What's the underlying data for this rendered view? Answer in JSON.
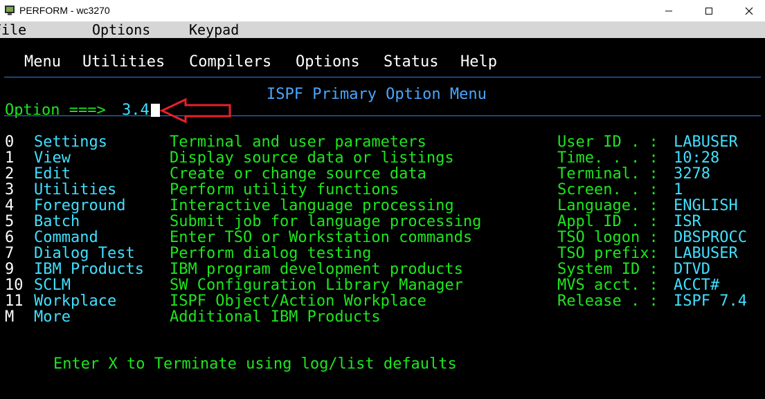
{
  "window": {
    "title": "PERFORM - wc3270",
    "icon": "terminal-icon",
    "controls": [
      "minimize-icon",
      "maximize-icon",
      "close-icon"
    ]
  },
  "menubar": {
    "items": [
      "File",
      "Options",
      "Keypad"
    ]
  },
  "action_bar": {
    "items": [
      "Menu",
      "Utilities",
      "Compilers",
      "Options",
      "Status",
      "Help"
    ]
  },
  "panel": {
    "title": "ISPF Primary Option Menu",
    "option_prompt": "Option ===>",
    "option_value": "3.4"
  },
  "options": [
    {
      "key": "0",
      "name": "Settings",
      "desc": "Terminal and user parameters"
    },
    {
      "key": "1",
      "name": "View",
      "desc": "Display source data or listings"
    },
    {
      "key": "2",
      "name": "Edit",
      "desc": "Create or change source data"
    },
    {
      "key": "3",
      "name": "Utilities",
      "desc": "Perform utility functions"
    },
    {
      "key": "4",
      "name": "Foreground",
      "desc": "Interactive language processing"
    },
    {
      "key": "5",
      "name": "Batch",
      "desc": "Submit job for language processing"
    },
    {
      "key": "6",
      "name": "Command",
      "desc": "Enter TSO or Workstation commands"
    },
    {
      "key": "7",
      "name": "Dialog Test",
      "desc": "Perform dialog testing"
    },
    {
      "key": "9",
      "name": "IBM Products",
      "desc": "IBM program development products"
    },
    {
      "key": "10",
      "name": "SCLM",
      "desc": "SW Configuration Library Manager"
    },
    {
      "key": "11",
      "name": "Workplace",
      "desc": "ISPF Object/Action Workplace"
    },
    {
      "key": "M",
      "name": "More",
      "desc": "Additional IBM Products"
    }
  ],
  "info": [
    {
      "label": "User ID . :",
      "value": "LABUSER"
    },
    {
      "label": "Time. . . :",
      "value": "10:28"
    },
    {
      "label": "Terminal. :",
      "value": "3278"
    },
    {
      "label": "Screen. . :",
      "value": "1"
    },
    {
      "label": "Language. :",
      "value": "ENGLISH"
    },
    {
      "label": "Appl ID . :",
      "value": "ISR"
    },
    {
      "label": "TSO logon :",
      "value": "DBSPROCC"
    },
    {
      "label": "TSO prefix:",
      "value": "LABUSER"
    },
    {
      "label": "System ID :",
      "value": "DTVD"
    },
    {
      "label": "MVS acct. :",
      "value": "ACCT#"
    },
    {
      "label": "Release . :",
      "value": "ISPF 7.4"
    }
  ],
  "footer": "Enter X to Terminate using log/list defaults",
  "annotation": {
    "type": "arrow",
    "icon": "left-arrow-icon",
    "color": "#e8202a"
  }
}
